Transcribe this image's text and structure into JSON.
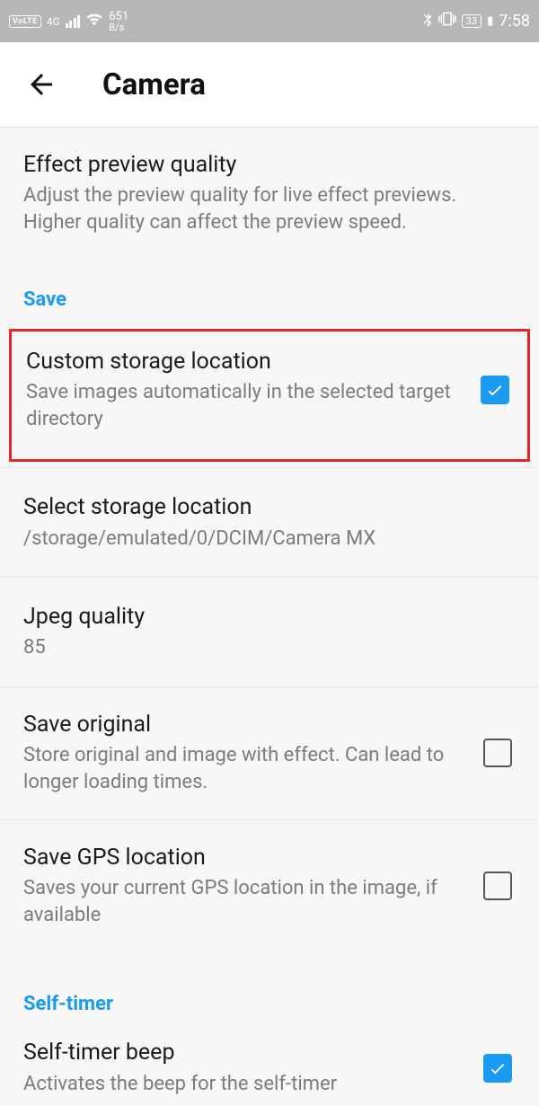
{
  "status": {
    "volte": "VoLTE",
    "nettype": "4G",
    "speed_num": "651",
    "speed_unit": "B/s",
    "battery": "33",
    "time": "7:58"
  },
  "header": {
    "title": "Camera"
  },
  "effect": {
    "title": "Effect preview quality",
    "desc": "Adjust the preview quality for live effect previews. Higher quality can affect the preview speed."
  },
  "sections": {
    "save": "Save",
    "selftimer": "Self-timer"
  },
  "custom_storage": {
    "title": "Custom storage location",
    "desc": "Save images automatically in the selected target directory"
  },
  "select_storage": {
    "title": "Select storage location",
    "desc": "/storage/emulated/0/DCIM/Camera MX"
  },
  "jpeg": {
    "title": "Jpeg quality",
    "value": "85"
  },
  "save_original": {
    "title": "Save original",
    "desc": "Store original and image with effect. Can lead to longer loading times."
  },
  "save_gps": {
    "title": "Save GPS location",
    "desc": "Saves your current GPS location in the image, if available"
  },
  "selftimer_beep": {
    "title": "Self-timer beep",
    "desc": "Activates the beep for the self-timer"
  }
}
